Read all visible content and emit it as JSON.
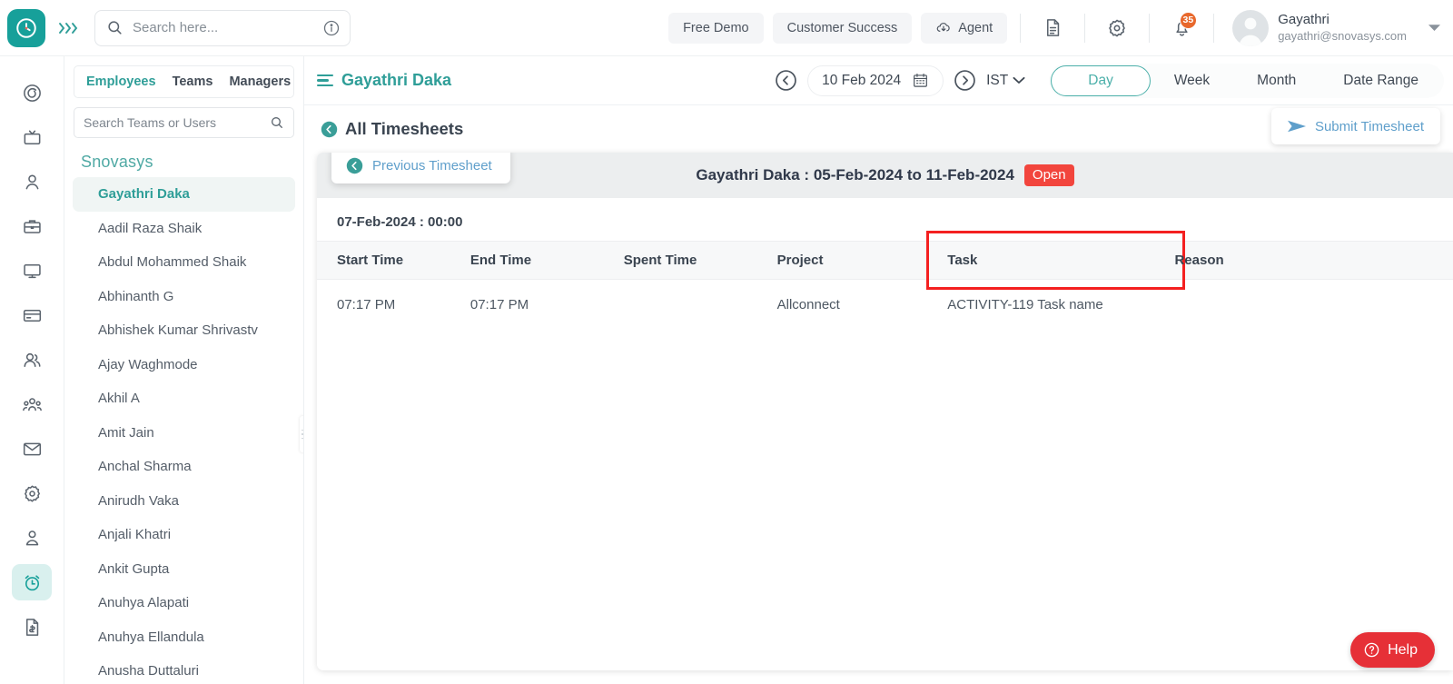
{
  "topbar": {
    "logo_icon": "clock-logo-icon",
    "expand_icon": "chevrons-right-icon",
    "search": {
      "placeholder": "Search here...",
      "value": "",
      "search_icon": "search-icon",
      "info_icon": "info-circle-icon"
    },
    "actions": [
      {
        "label": "Free Demo",
        "name": "free-demo-button",
        "icon": null
      },
      {
        "label": "Customer Success",
        "name": "customer-success-button",
        "icon": null
      },
      {
        "label": "Agent",
        "name": "agent-button",
        "icon": "cloud-download-icon"
      }
    ],
    "doc_icon": "document-icon",
    "settings_icon": "gear-icon",
    "bell_icon": "bell-icon",
    "notification_count": "35",
    "profile": {
      "name": "Gayathri",
      "email": "gayathri@snovasys.com",
      "avatar_icon": "avatar-icon",
      "caret_icon": "chevron-down-icon"
    }
  },
  "rail": {
    "items": [
      {
        "name": "sidebar-item-dashboard",
        "icon": "spiral-icon",
        "active": false
      },
      {
        "name": "sidebar-item-announcements",
        "icon": "tv-icon",
        "active": false
      },
      {
        "name": "sidebar-item-profile",
        "icon": "user-icon",
        "active": false
      },
      {
        "name": "sidebar-item-jobs",
        "icon": "briefcase-icon",
        "active": false
      },
      {
        "name": "sidebar-item-assets",
        "icon": "monitor-icon",
        "active": false
      },
      {
        "name": "sidebar-item-payments",
        "icon": "credit-card-icon",
        "active": false
      },
      {
        "name": "sidebar-item-employees",
        "icon": "users-icon",
        "active": false
      },
      {
        "name": "sidebar-item-teams",
        "icon": "group-icon",
        "active": false
      },
      {
        "name": "sidebar-item-mail",
        "icon": "envelope-icon",
        "active": false
      },
      {
        "name": "sidebar-item-settings",
        "icon": "gear-icon",
        "active": false
      },
      {
        "name": "sidebar-item-account",
        "icon": "person-badge-icon",
        "active": false
      },
      {
        "name": "sidebar-item-timesheets",
        "icon": "alarm-clock-icon",
        "active": true
      },
      {
        "name": "sidebar-item-invoices",
        "icon": "invoice-icon",
        "active": false
      }
    ]
  },
  "employees_panel": {
    "tabs": [
      {
        "label": "Employees",
        "active": true
      },
      {
        "label": "Teams",
        "active": false
      },
      {
        "label": "Managers",
        "active": false
      }
    ],
    "search": {
      "placeholder": "Search Teams or Users",
      "value": "",
      "icon": "search-icon"
    },
    "org": "Snovasys",
    "list": [
      {
        "label": "Gayathri Daka",
        "active": true
      },
      {
        "label": "Aadil Raza Shaik",
        "active": false
      },
      {
        "label": "Abdul Mohammed Shaik",
        "active": false
      },
      {
        "label": "Abhinanth G",
        "active": false
      },
      {
        "label": "Abhishek Kumar Shrivastv",
        "active": false
      },
      {
        "label": "Ajay Waghmode",
        "active": false
      },
      {
        "label": "Akhil A",
        "active": false
      },
      {
        "label": "Amit Jain",
        "active": false
      },
      {
        "label": "Anchal Sharma",
        "active": false
      },
      {
        "label": "Anirudh Vaka",
        "active": false
      },
      {
        "label": "Anjali Khatri",
        "active": false
      },
      {
        "label": "Ankit Gupta",
        "active": false
      },
      {
        "label": "Anuhya Alapati",
        "active": false
      },
      {
        "label": "Anuhya Ellandula",
        "active": false
      },
      {
        "label": "Anusha Duttaluri",
        "active": false
      }
    ]
  },
  "main_header": {
    "menu_icon": "hamburger-icon",
    "title": "Gayathri Daka",
    "prev_icon": "chevron-left-circle-icon",
    "date": "10 Feb 2024",
    "calendar_icon": "calendar-icon",
    "next_icon": "chevron-right-circle-icon",
    "timezone": "IST",
    "timezone_caret_icon": "chevron-down-icon",
    "range_tabs": [
      {
        "label": "Day",
        "active": true
      },
      {
        "label": "Week",
        "active": false
      },
      {
        "label": "Month",
        "active": false
      },
      {
        "label": "Date Range",
        "active": false
      }
    ]
  },
  "sub_header": {
    "back_icon": "back-circle-icon",
    "back_label": "All Timesheets",
    "submit_label": "Submit Timesheet",
    "submit_icon": "send-icon"
  },
  "timesheet": {
    "prev_button_label": "Previous Timesheet",
    "prev_button_icon": "back-circle-icon",
    "title": "Gayathri Daka : 05-Feb-2024 to 11-Feb-2024",
    "status": "Open",
    "status_color": "#f2453d",
    "day_label": "07-Feb-2024 : 00:00",
    "columns": [
      "Start Time",
      "End Time",
      "Spent Time",
      "Project",
      "Task",
      "Reason"
    ],
    "highlighted_column": "Task",
    "highlight_color": "#f42020",
    "rows": [
      {
        "start_time": "07:17 PM",
        "end_time": "07:17 PM",
        "spent_time": "",
        "project": "Allconnect",
        "task": "ACTIVITY-119 Task name",
        "reason": ""
      }
    ]
  },
  "help": {
    "label": "Help",
    "icon": "question-circle-icon",
    "color": "#e63037"
  },
  "theme": {
    "accent": "#2f9e98",
    "accent_light": "#d9f0ee",
    "link": "#5f9fcb"
  }
}
